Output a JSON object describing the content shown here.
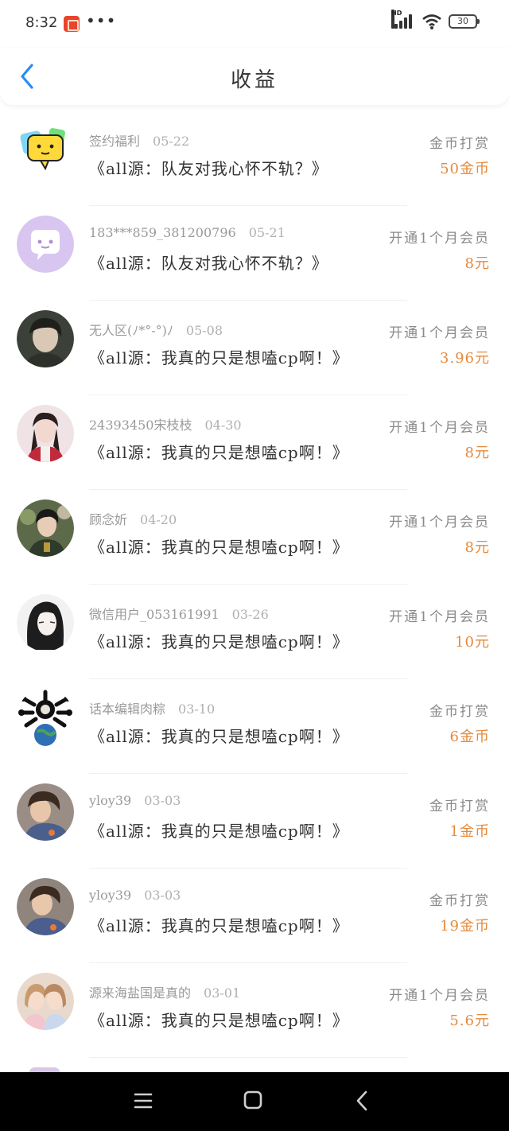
{
  "status_bar": {
    "time": "8:32",
    "dots": "•••",
    "network_label": "HD",
    "battery": "30"
  },
  "header": {
    "title": "收益"
  },
  "colors": {
    "amount": "#e58a3c",
    "name_gray": "#9a9a9a",
    "title": "#333333"
  },
  "rows": [
    {
      "name": "签约福利",
      "date": "05-22",
      "book": "《all源：队友对我心怀不轨？》",
      "type": "金币打赏",
      "amount": "50金币",
      "avatar_icon": "chat-bubble-emoji-icon"
    },
    {
      "name": "183***859_381200796",
      "date": "05-21",
      "book": "《all源：队友对我心怀不轨？》",
      "type": "开通1个月会员",
      "amount": "8元",
      "avatar_icon": "default-chat-avatar-icon"
    },
    {
      "name": "无人区(ﾉ*°-°)ﾉ",
      "date": "05-08",
      "book": "《all源：我真的只是想嗑cp啊！》",
      "type": "开通1个月会员",
      "amount": "3.96元",
      "avatar_icon": "user-photo"
    },
    {
      "name": "24393450宋枝枝",
      "date": "04-30",
      "book": "《all源：我真的只是想嗑cp啊！》",
      "type": "开通1个月会员",
      "amount": "8元",
      "avatar_icon": "user-photo"
    },
    {
      "name": "顾念妡",
      "date": "04-20",
      "book": "《all源：我真的只是想嗑cp啊！》",
      "type": "开通1个月会员",
      "amount": "8元",
      "avatar_icon": "user-photo"
    },
    {
      "name": "微信用户_053161991",
      "date": "03-26",
      "book": "《all源：我真的只是想嗑cp啊！》",
      "type": "开通1个月会员",
      "amount": "10元",
      "avatar_icon": "user-photo"
    },
    {
      "name": "话本编辑肉粽",
      "date": "03-10",
      "book": "《all源：我真的只是想嗑cp啊！》",
      "type": "金币打赏",
      "amount": "6金币",
      "avatar_icon": "user-photo"
    },
    {
      "name": "yloy39",
      "date": "03-03",
      "book": "《all源：我真的只是想嗑cp啊！》",
      "type": "金币打赏",
      "amount": "1金币",
      "avatar_icon": "user-photo"
    },
    {
      "name": "yloy39",
      "date": "03-03",
      "book": "《all源：我真的只是想嗑cp啊！》",
      "type": "金币打赏",
      "amount": "19金币",
      "avatar_icon": "user-photo"
    },
    {
      "name": "源来海盐国是真的",
      "date": "03-01",
      "book": "《all源：我真的只是想嗑cp啊！》",
      "type": "开通1个月会员",
      "amount": "5.6元",
      "avatar_icon": "user-photo"
    }
  ]
}
